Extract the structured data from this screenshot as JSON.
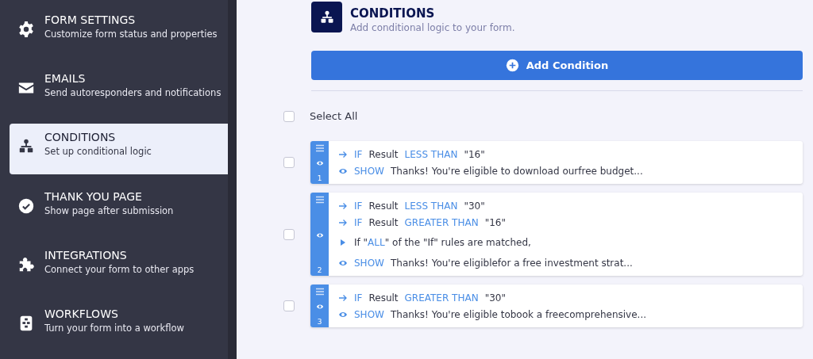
{
  "sidebar": {
    "items": [
      {
        "title": "FORM SETTINGS",
        "subtitle": "Customize form status and properties",
        "selected": false
      },
      {
        "title": "EMAILS",
        "subtitle": "Send autoresponders and notifications",
        "selected": false
      },
      {
        "title": "CONDITIONS",
        "subtitle": "Set up conditional logic",
        "selected": true
      },
      {
        "title": "THANK YOU PAGE",
        "subtitle": "Show page after submission",
        "selected": false
      },
      {
        "title": "INTEGRATIONS",
        "subtitle": "Connect your form to other apps",
        "selected": false
      },
      {
        "title": "WORKFLOWS",
        "subtitle": "Turn your form into a workflow",
        "selected": false
      }
    ]
  },
  "header": {
    "title": "CONDITIONS",
    "subtitle": "Add conditional logic to your form."
  },
  "add_button": {
    "label": "Add Condition"
  },
  "select_all": {
    "label": "Select All",
    "checked": false
  },
  "conditions": [
    {
      "checked": false,
      "number": "1",
      "rules": [
        {
          "kind": "if",
          "keyword": "IF",
          "field": "Result",
          "operator": "LESS THAN",
          "value": "\"16\""
        },
        {
          "kind": "show",
          "keyword": "SHOW",
          "text": "Thanks! You're eligible to download ourfree budget..."
        }
      ]
    },
    {
      "checked": false,
      "number": "2",
      "rules": [
        {
          "kind": "if",
          "keyword": "IF",
          "field": "Result",
          "operator": "LESS THAN",
          "value": "\"30\""
        },
        {
          "kind": "if",
          "keyword": "IF",
          "field": "Result",
          "operator": "GREATER THAN",
          "value": "\"16\""
        },
        {
          "kind": "match",
          "before": "If \"",
          "highlight": "ALL",
          "after": "\" of the \"If\" rules are matched,"
        },
        {
          "kind": "show",
          "keyword": "SHOW",
          "text": "Thanks! You're eligiblefor a free investment strat..."
        }
      ]
    },
    {
      "checked": false,
      "number": "3",
      "rules": [
        {
          "kind": "if",
          "keyword": "IF",
          "field": "Result",
          "operator": "GREATER THAN",
          "value": "\"30\""
        },
        {
          "kind": "show",
          "keyword": "SHOW",
          "text": "Thanks! You're eligible tobook a freecomprehensive..."
        }
      ]
    }
  ]
}
